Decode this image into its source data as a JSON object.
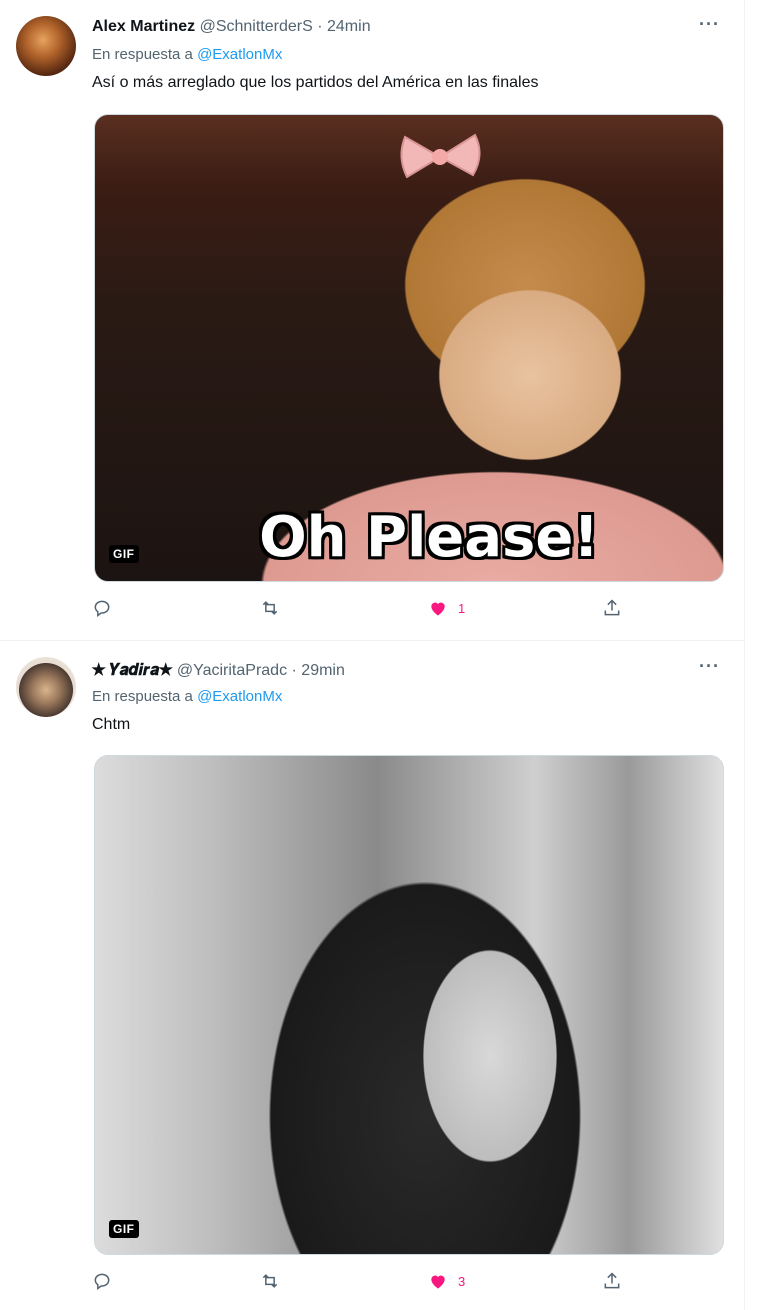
{
  "tweets": [
    {
      "name": "Alex Martinez",
      "handle": "@SchnitterderS",
      "time": "· 24min",
      "reply_prefix": "En respuesta a",
      "reply_to": "@ExatlonMx",
      "text": "Así o más arreglado que los partidos del América en las finales",
      "media_caption": "Oh Please!",
      "media_badge": "GIF",
      "likes": "1",
      "more_label": "···"
    },
    {
      "name": "✭ 𝒀𝒂𝒅𝒊𝒓𝒂✭",
      "handle": "@YaciritaPradc",
      "time": "· 29min",
      "reply_prefix": "En respuesta a",
      "reply_to": "@ExatlonMx",
      "text": "Chtm",
      "media_badge": "GIF",
      "likes": "3",
      "more_label": "···"
    }
  ],
  "icons": {
    "reply": "reply-icon",
    "retweet": "retweet-icon",
    "like": "heart-icon",
    "share": "share-icon",
    "more": "more-icon"
  },
  "colors": {
    "like": "#f91880",
    "link": "#1d9bf0",
    "muted": "#536471"
  }
}
